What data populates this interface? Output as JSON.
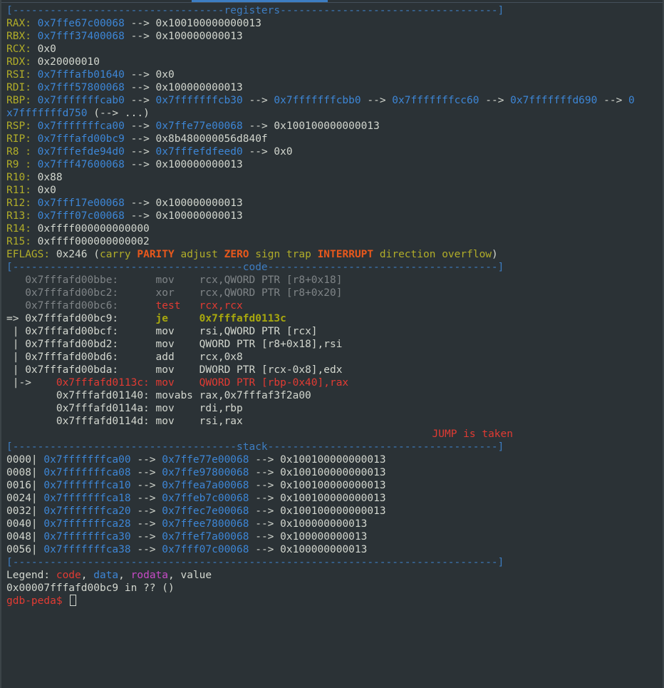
{
  "separators": {
    "registers": "[----------------------------------registers-----------------------------------]",
    "code": "[-------------------------------------code-------------------------------------]",
    "stack": "[------------------------------------stack-------------------------------------]",
    "end": "[------------------------------------------------------------------------------]"
  },
  "registers": [
    {
      "name": "RAX:",
      "chain": [
        {
          "t": "0x7ffe67c00068",
          "c": "addr"
        },
        {
          "t": " --> ",
          "c": "val"
        },
        {
          "t": "0x100100000000013",
          "c": "val"
        }
      ]
    },
    {
      "name": "RBX:",
      "chain": [
        {
          "t": "0x7fff37400068",
          "c": "addr"
        },
        {
          "t": " --> ",
          "c": "val"
        },
        {
          "t": "0x100000000013",
          "c": "val"
        }
      ]
    },
    {
      "name": "RCX:",
      "chain": [
        {
          "t": "0x0",
          "c": "val"
        }
      ]
    },
    {
      "name": "RDX:",
      "chain": [
        {
          "t": "0x20000010",
          "c": "val"
        }
      ]
    },
    {
      "name": "RSI:",
      "chain": [
        {
          "t": "0x7fffafb01640",
          "c": "addr"
        },
        {
          "t": " --> ",
          "c": "val"
        },
        {
          "t": "0x0",
          "c": "val"
        }
      ]
    },
    {
      "name": "RDI:",
      "chain": [
        {
          "t": "0x7fff57800068",
          "c": "addr"
        },
        {
          "t": " --> ",
          "c": "val"
        },
        {
          "t": "0x100000000013",
          "c": "val"
        }
      ]
    },
    {
      "name": "RBP:",
      "chain": [
        {
          "t": "0x7fffffffcab0",
          "c": "addr"
        },
        {
          "t": " --> ",
          "c": "val"
        },
        {
          "t": "0x7fffffffcb30",
          "c": "addr"
        },
        {
          "t": " --> ",
          "c": "val"
        },
        {
          "t": "0x7fffffffcbb0",
          "c": "addr"
        },
        {
          "t": " --> ",
          "c": "val"
        },
        {
          "t": "0x7fffffffcc60",
          "c": "addr"
        },
        {
          "t": " --> ",
          "c": "val"
        },
        {
          "t": "0x7fffffffd690",
          "c": "addr"
        },
        {
          "t": " --> ",
          "c": "val"
        },
        {
          "t": "0",
          "c": "addr"
        }
      ]
    },
    {
      "name": "",
      "chain": [
        {
          "t": "x7fffffffd750",
          "c": "addr"
        },
        {
          "t": " (--> ...)",
          "c": "val"
        }
      ]
    },
    {
      "name": "RSP:",
      "chain": [
        {
          "t": "0x7fffffffca00",
          "c": "addr"
        },
        {
          "t": " --> ",
          "c": "val"
        },
        {
          "t": "0x7ffe77e00068",
          "c": "addr"
        },
        {
          "t": " --> ",
          "c": "val"
        },
        {
          "t": "0x100100000000013",
          "c": "val"
        }
      ]
    },
    {
      "name": "RIP:",
      "chain": [
        {
          "t": "0x7fffafd00bc9",
          "c": "addr"
        },
        {
          "t": " --> ",
          "c": "val"
        },
        {
          "t": "0x8b480000056d840f",
          "c": "val"
        }
      ]
    },
    {
      "name": "R8 :",
      "chain": [
        {
          "t": "0x7fffefde94d0",
          "c": "addr"
        },
        {
          "t": " --> ",
          "c": "val"
        },
        {
          "t": "0x7fffefdfeed0",
          "c": "addr"
        },
        {
          "t": " --> ",
          "c": "val"
        },
        {
          "t": "0x0",
          "c": "val"
        }
      ]
    },
    {
      "name": "R9 :",
      "chain": [
        {
          "t": "0x7fff47600068",
          "c": "addr"
        },
        {
          "t": " --> ",
          "c": "val"
        },
        {
          "t": "0x100000000013",
          "c": "val"
        }
      ]
    },
    {
      "name": "R10:",
      "chain": [
        {
          "t": "0x88",
          "c": "val"
        }
      ]
    },
    {
      "name": "R11:",
      "chain": [
        {
          "t": "0x0",
          "c": "val"
        }
      ]
    },
    {
      "name": "R12:",
      "chain": [
        {
          "t": "0x7fff17e00068",
          "c": "addr"
        },
        {
          "t": " --> ",
          "c": "val"
        },
        {
          "t": "0x100000000013",
          "c": "val"
        }
      ]
    },
    {
      "name": "R13:",
      "chain": [
        {
          "t": "0x7fff07c00068",
          "c": "addr"
        },
        {
          "t": " --> ",
          "c": "val"
        },
        {
          "t": "0x100000000013",
          "c": "val"
        }
      ]
    },
    {
      "name": "R14:",
      "chain": [
        {
          "t": "0xffff000000000000",
          "c": "val"
        }
      ]
    },
    {
      "name": "R15:",
      "chain": [
        {
          "t": "0xffff000000000002",
          "c": "val"
        }
      ]
    }
  ],
  "eflags": {
    "label": "EFLAGS:",
    "value": "0x246",
    "flags": [
      {
        "t": "carry",
        "on": false
      },
      {
        "t": "PARITY",
        "on": true
      },
      {
        "t": "adjust",
        "on": false
      },
      {
        "t": "ZERO",
        "on": true
      },
      {
        "t": "sign",
        "on": false
      },
      {
        "t": "trap",
        "on": false
      },
      {
        "t": "INTERRUPT",
        "on": true
      },
      {
        "t": "direction",
        "on": false
      },
      {
        "t": "overflow",
        "on": false
      }
    ]
  },
  "code": [
    {
      "prefix": "   ",
      "addr": "0x7fffafd00bbe:",
      "pad": "      ",
      "mn": "mov  ",
      "ops": "  rcx,QWORD PTR [r8+0x18]",
      "style": "dim"
    },
    {
      "prefix": "   ",
      "addr": "0x7fffafd00bc2:",
      "pad": "      ",
      "mn": "xor  ",
      "ops": "  rcx,QWORD PTR [r8+0x20]",
      "style": "dim"
    },
    {
      "prefix": "   ",
      "addr": "0x7fffafd00bc6:",
      "pad": "      ",
      "mn": "test ",
      "ops": "  rcx,rcx",
      "style": "dimred"
    },
    {
      "prefix": "=> ",
      "addr": "0x7fffafd00bc9:",
      "pad": "      ",
      "mn": "je   ",
      "ops": "  0x7fffafd0113c",
      "style": "current"
    },
    {
      "prefix": " | ",
      "addr": "0x7fffafd00bcf:",
      "pad": "      ",
      "mn": "mov  ",
      "ops": "  rsi,QWORD PTR [rcx]",
      "style": "normal"
    },
    {
      "prefix": " | ",
      "addr": "0x7fffafd00bd2:",
      "pad": "      ",
      "mn": "mov  ",
      "ops": "  QWORD PTR [r8+0x18],rsi",
      "style": "normal"
    },
    {
      "prefix": " | ",
      "addr": "0x7fffafd00bd6:",
      "pad": "      ",
      "mn": "add  ",
      "ops": "  rcx,0x8",
      "style": "normal"
    },
    {
      "prefix": " | ",
      "addr": "0x7fffafd00bda:",
      "pad": "      ",
      "mn": "mov  ",
      "ops": "  DWORD PTR [rcx-0x8],edx",
      "style": "normal"
    },
    {
      "prefix": " |->    ",
      "addr": "0x7fffafd0113c:",
      "pad": " ",
      "mn": "mov  ",
      "ops": "  QWORD PTR [rbp-0x40],rax",
      "style": "target"
    },
    {
      "prefix": "        ",
      "addr": "0x7fffafd01140:",
      "pad": " ",
      "mn": "movabs",
      "ops": " rax,0x7fffaf3f2a00",
      "style": "normal"
    },
    {
      "prefix": "        ",
      "addr": "0x7fffafd0114a:",
      "pad": " ",
      "mn": "mov  ",
      "ops": "  rdi,rbp",
      "style": "normal"
    },
    {
      "prefix": "        ",
      "addr": "0x7fffafd0114d:",
      "pad": " ",
      "mn": "mov  ",
      "ops": "  rsi,rax",
      "style": "normal"
    }
  ],
  "jump_text": "JUMP is taken",
  "stack": [
    {
      "off": "0000|",
      "a1": "0x7fffffffca00",
      "a2": "0x7ffe77e00068",
      "v": "0x100100000000013"
    },
    {
      "off": "0008|",
      "a1": "0x7fffffffca08",
      "a2": "0x7ffe97800068",
      "v": "0x100100000000013"
    },
    {
      "off": "0016|",
      "a1": "0x7fffffffca10",
      "a2": "0x7ffea7a00068",
      "v": "0x100100000000013"
    },
    {
      "off": "0024|",
      "a1": "0x7fffffffca18",
      "a2": "0x7ffeb7c00068",
      "v": "0x100100000000013"
    },
    {
      "off": "0032|",
      "a1": "0x7fffffffca20",
      "a2": "0x7ffec7e00068",
      "v": "0x100100000000013"
    },
    {
      "off": "0040|",
      "a1": "0x7fffffffca28",
      "a2": "0x7ffee7800068",
      "v": "0x100000000013"
    },
    {
      "off": "0048|",
      "a1": "0x7fffffffca30",
      "a2": "0x7ffef7a00068",
      "v": "0x100000000013"
    },
    {
      "off": "0056|",
      "a1": "0x7fffffffca38",
      "a2": "0x7fff07c00068",
      "v": "0x100000000013"
    }
  ],
  "legend": {
    "label": "Legend: ",
    "code": "code",
    "data": "data",
    "rodata": "rodata",
    "value": "value"
  },
  "location": "0x00007fffafd00bc9 in ?? ()",
  "prompt": "gdb-peda$",
  "colors": {
    "background": "#2b3236",
    "address": "#3d86d6",
    "register": "#b1ad29",
    "code": "#e23b33",
    "flag_on": "#e8581c"
  }
}
